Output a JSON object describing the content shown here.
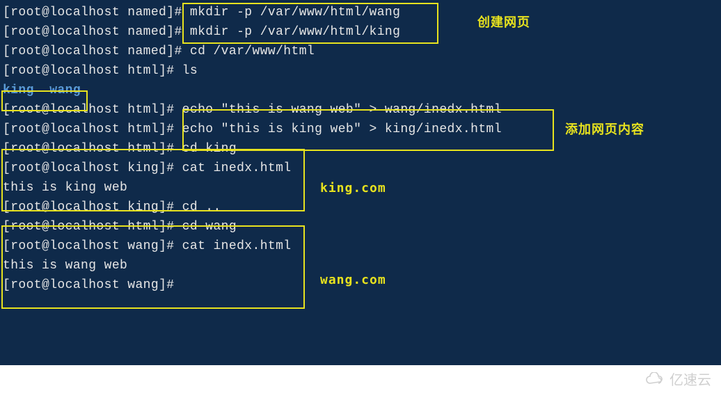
{
  "term": {
    "user": "root",
    "host": "localhost",
    "lines": [
      {
        "dir": "named",
        "cmd": "mkdir -p /var/www/html/wang"
      },
      {
        "dir": "named",
        "cmd": "mkdir -p /var/www/html/king"
      },
      {
        "dir": "named",
        "cmd": "cd /var/www/html"
      },
      {
        "dir": "html",
        "cmd": "ls"
      },
      {
        "output": "king  wang",
        "cls": "blue"
      },
      {
        "dir": "html",
        "cmd": "echo \"this is wang web\" > wang/inedx.html"
      },
      {
        "dir": "html",
        "cmd": "echo \"this is king web\" > king/inedx.html"
      },
      {
        "dir": "html",
        "cmd": "cd king"
      },
      {
        "dir": "king",
        "cmd": "cat inedx.html"
      },
      {
        "output": "this is king web"
      },
      {
        "dir": "king",
        "cmd": "cd .."
      },
      {
        "dir": "html",
        "cmd": "cd wang"
      },
      {
        "dir": "wang",
        "cmd": "cat inedx.html"
      },
      {
        "output": "this is wang web"
      },
      {
        "dir": "wang",
        "cmd": ""
      }
    ]
  },
  "annotations": {
    "a1": "创建网页",
    "a2": "添加网页内容",
    "a3": "king.com",
    "a4": "wang.com"
  },
  "watermark": "亿速云"
}
